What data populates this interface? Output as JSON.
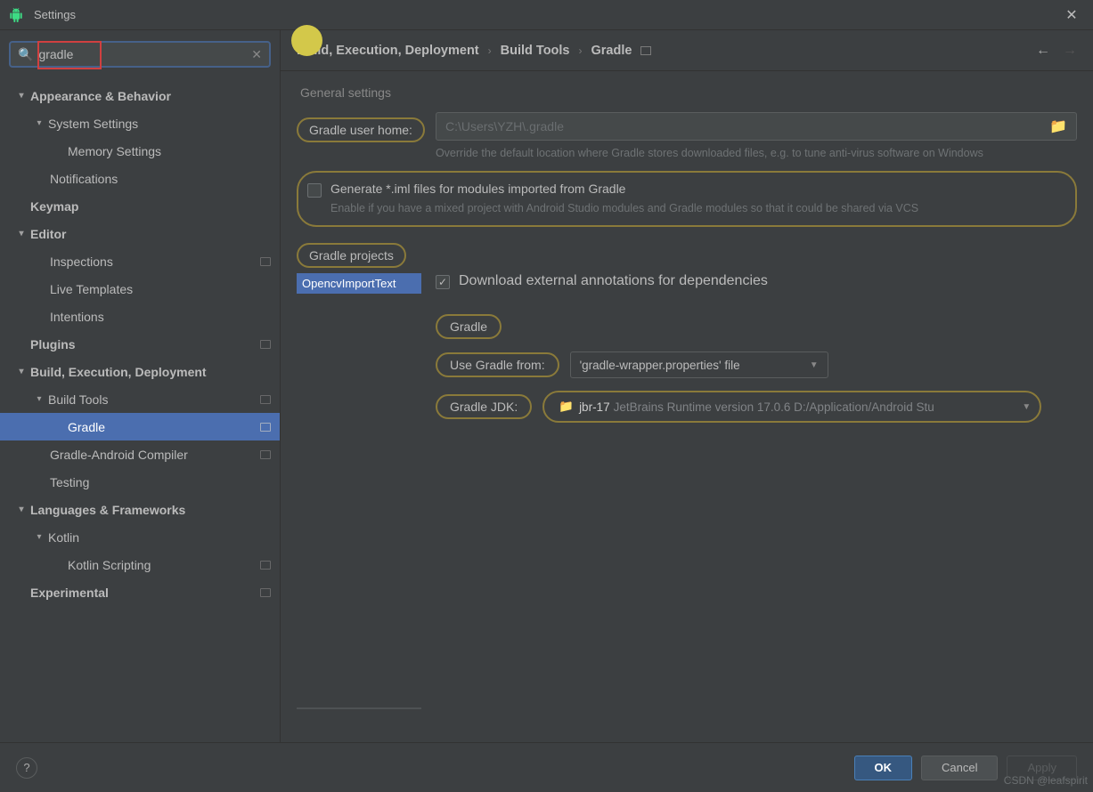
{
  "window": {
    "title": "Settings"
  },
  "search": {
    "value": "gradle",
    "placeholder": ""
  },
  "tree": {
    "appearance": "Appearance & Behavior",
    "system_settings": "System Settings",
    "memory_settings": "Memory Settings",
    "notifications": "Notifications",
    "keymap": "Keymap",
    "editor": "Editor",
    "inspections": "Inspections",
    "live_templates": "Live Templates",
    "intentions": "Intentions",
    "plugins": "Plugins",
    "bed": "Build, Execution, Deployment",
    "build_tools": "Build Tools",
    "gradle": "Gradle",
    "gradle_android": "Gradle-Android Compiler",
    "testing": "Testing",
    "lang_fw": "Languages & Frameworks",
    "kotlin": "Kotlin",
    "kotlin_scripting": "Kotlin Scripting",
    "experimental": "Experimental"
  },
  "breadcrumb": {
    "a": "Build, Execution, Deployment",
    "b": "Build Tools",
    "c": "Gradle"
  },
  "general": {
    "section": "General settings",
    "user_home_label": "Gradle user home:",
    "user_home_placeholder": "C:\\Users\\YZH\\.gradle",
    "user_home_hint": "Override the default location where Gradle stores downloaded files, e.g. to tune anti-virus software on Windows",
    "iml_title": "Generate *.iml files for modules imported from Gradle",
    "iml_hint": "Enable if you have a mixed project with Android Studio modules and Gradle modules so that it could be shared via VCS"
  },
  "projects": {
    "section": "Gradle projects",
    "item": "OpencvImportText",
    "download_label": "Download external annotations for dependencies",
    "gradle_label": "Gradle",
    "use_gradle_from_label": "Use Gradle from:",
    "use_gradle_from_value": "'gradle-wrapper.properties' file",
    "gradle_jdk_label": "Gradle JDK:",
    "jdk_name": "jbr-17",
    "jdk_path": "JetBrains Runtime version 17.0.6 D:/Application/Android Stu"
  },
  "buttons": {
    "ok": "OK",
    "cancel": "Cancel",
    "apply": "Apply"
  },
  "watermark": "CSDN @leafspirit"
}
